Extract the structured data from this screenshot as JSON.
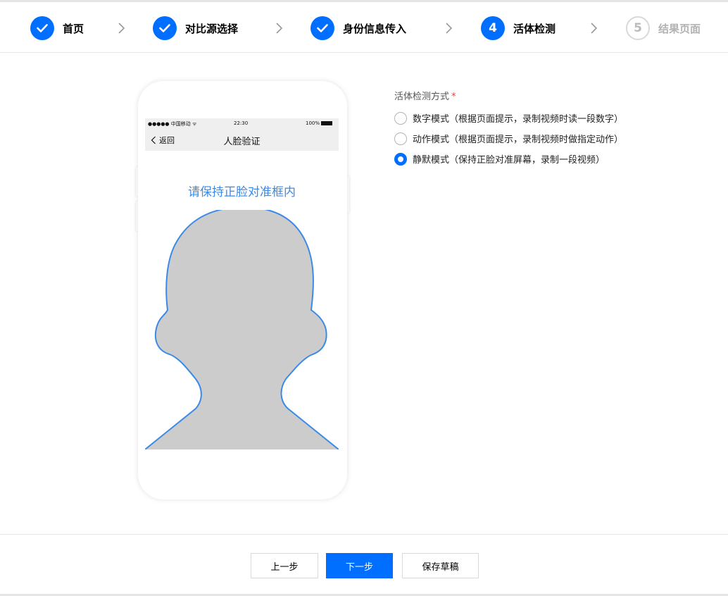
{
  "steps": [
    {
      "label": "首页",
      "state": "done"
    },
    {
      "label": "对比源选择",
      "state": "done"
    },
    {
      "label": "身份信息传入",
      "state": "done"
    },
    {
      "label": "活体检测",
      "number": "4",
      "state": "current"
    },
    {
      "label": "结果页面",
      "number": "5",
      "state": "future"
    }
  ],
  "phone": {
    "carrier": "●●●●● 中国移动 ᯤ",
    "time": "22:30",
    "battery": "100%",
    "back_label": "返回",
    "title": "人脸验证",
    "prompt": "请保持正脸对准框内"
  },
  "form": {
    "label": "活体检测方式",
    "required_mark": "*",
    "options": [
      {
        "label": "数字模式（根据页面提示，录制视频时读一段数字）",
        "checked": false
      },
      {
        "label": "动作模式（根据页面提示，录制视频时做指定动作）",
        "checked": false
      },
      {
        "label": "静默模式（保持正脸对准屏幕，录制一段视频）",
        "checked": true
      }
    ]
  },
  "footer": {
    "prev_label": "上一步",
    "next_label": "下一步",
    "save_label": "保存草稿"
  },
  "colors": {
    "accent": "#006eff",
    "prompt": "#3b8ae6",
    "silhouette_fill": "#cccccc",
    "silhouette_stroke": "#3b8ae6"
  }
}
